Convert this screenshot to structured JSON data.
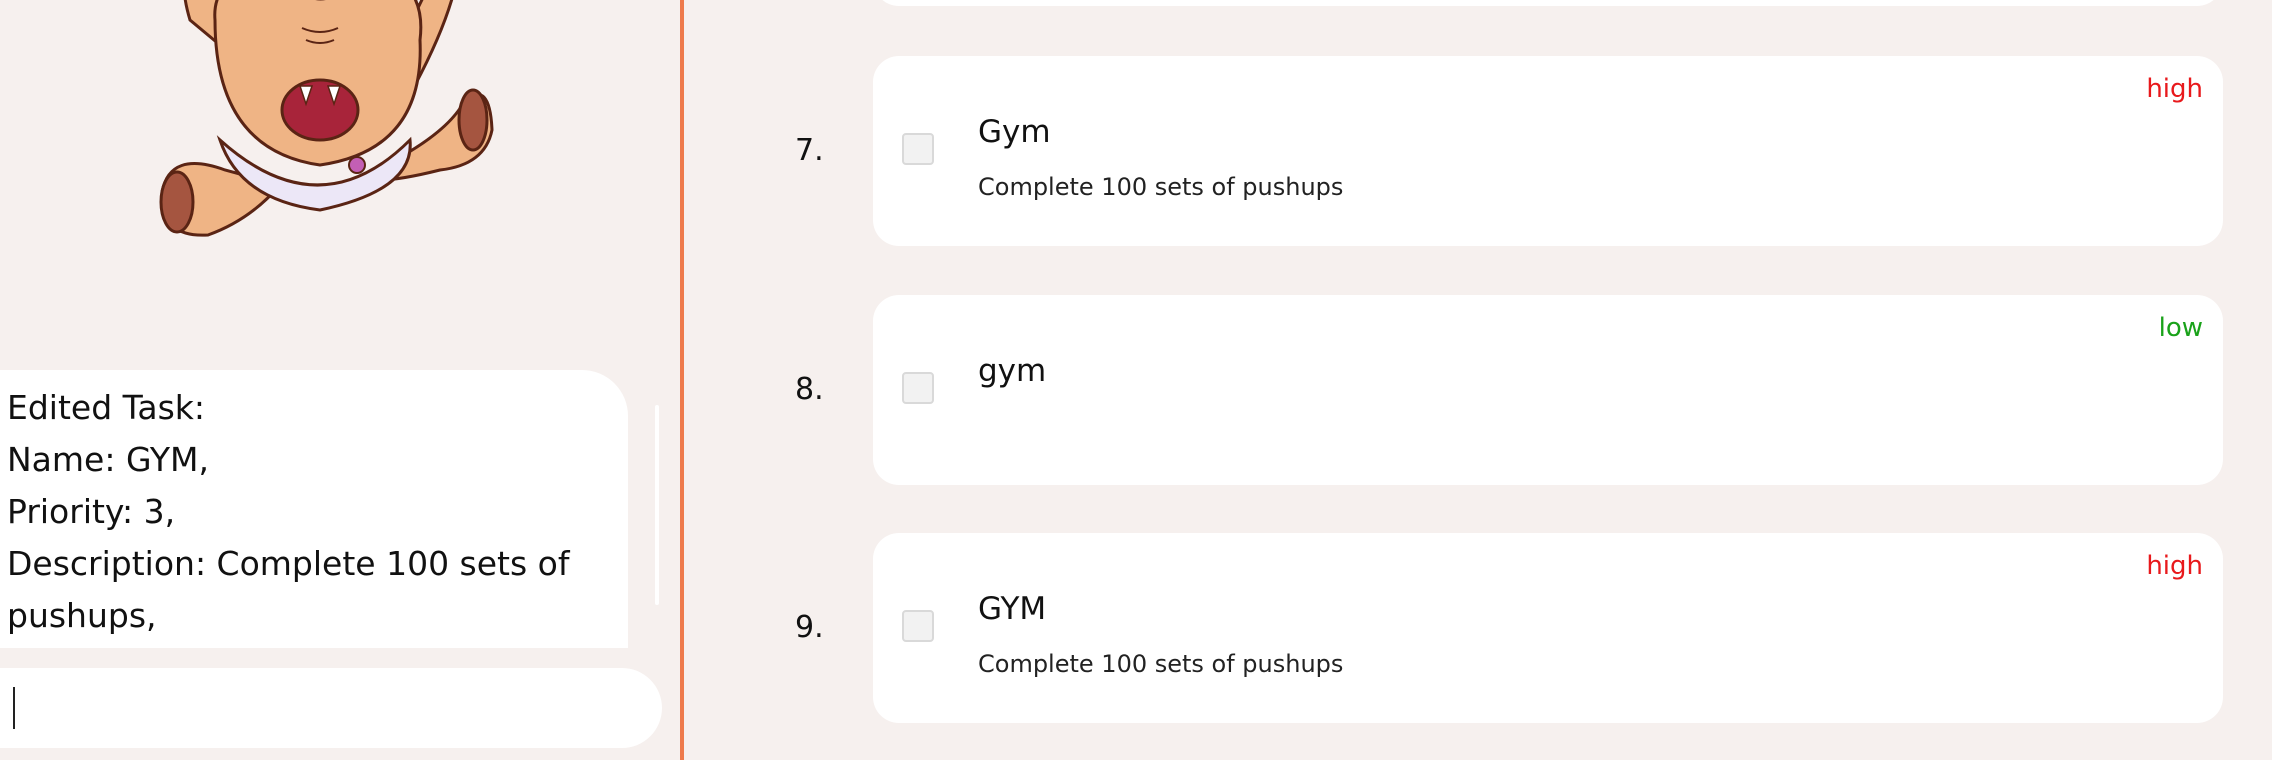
{
  "chat": {
    "lines": [
      "Edited Task:",
      "Name: GYM,",
      "Priority: 3,",
      "Description: Complete 100 sets of",
      "pushups,"
    ],
    "input_value": ""
  },
  "tasks": [
    {
      "number": "7.",
      "title": "Gym",
      "description": "Complete 100 sets of pushups",
      "priority": "high",
      "priority_color": "#e8191c",
      "checked": false
    },
    {
      "number": "8.",
      "title": "gym",
      "description": "",
      "priority": "low",
      "priority_color": "#1aa21a",
      "checked": false
    },
    {
      "number": "9.",
      "title": "GYM",
      "description": "Complete 100 sets of pushups",
      "priority": "high",
      "priority_color": "#e8191c",
      "checked": false
    }
  ],
  "colors": {
    "background": "#f6f0ee",
    "divider": "#ee7a4c",
    "card": "#ffffff"
  },
  "icons": {
    "mascot": "crying-baby-monster-illustration"
  }
}
